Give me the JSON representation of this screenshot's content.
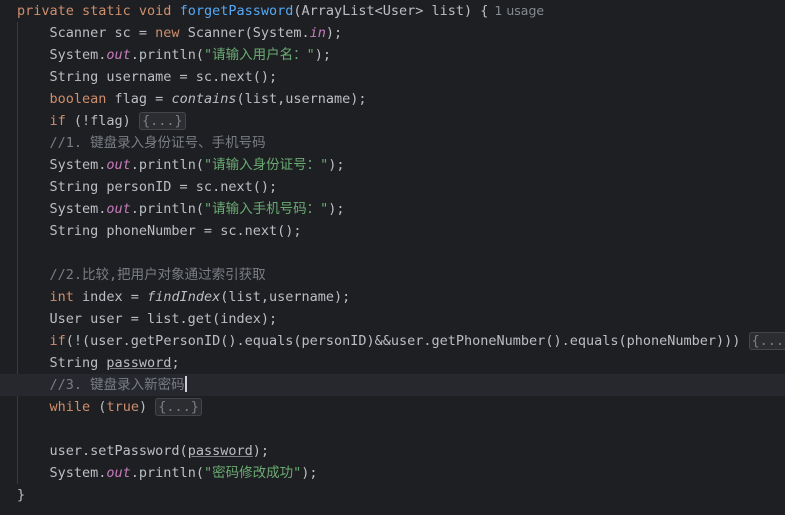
{
  "editor": {
    "usage_hint": "1 usage",
    "lines": [
      {
        "tokens": [
          {
            "t": "private static void ",
            "c": "kw"
          },
          {
            "t": "forgetPassword",
            "c": "fn"
          },
          {
            "t": "(ArrayList<User> list) {",
            "c": ""
          }
        ]
      },
      {
        "tokens": [
          {
            "t": "    Scanner sc = ",
            "c": ""
          },
          {
            "t": "new ",
            "c": "kw"
          },
          {
            "t": "Scanner(System.",
            "c": ""
          },
          {
            "t": "in",
            "c": "st"
          },
          {
            "t": ");",
            "c": ""
          }
        ]
      },
      {
        "tokens": [
          {
            "t": "    System.",
            "c": ""
          },
          {
            "t": "out",
            "c": "st"
          },
          {
            "t": ".println(",
            "c": ""
          },
          {
            "t": "\"请输入用户名：\"",
            "c": "str"
          },
          {
            "t": ");",
            "c": ""
          }
        ]
      },
      {
        "tokens": [
          {
            "t": "    String username = sc.next();",
            "c": ""
          }
        ]
      },
      {
        "tokens": [
          {
            "t": "    ",
            "c": ""
          },
          {
            "t": "boolean ",
            "c": "kw"
          },
          {
            "t": "flag = ",
            "c": ""
          },
          {
            "t": "contains",
            "c": "it"
          },
          {
            "t": "(list,username);",
            "c": ""
          }
        ]
      },
      {
        "tokens": [
          {
            "t": "    ",
            "c": ""
          },
          {
            "t": "if ",
            "c": "kw"
          },
          {
            "t": "(!flag) ",
            "c": ""
          },
          {
            "t": "{...}",
            "c": "fold"
          }
        ]
      },
      {
        "tokens": [
          {
            "t": "    //1. 键盘录入身份证号、手机号码",
            "c": "cm"
          }
        ]
      },
      {
        "tokens": [
          {
            "t": "    System.",
            "c": ""
          },
          {
            "t": "out",
            "c": "st"
          },
          {
            "t": ".println(",
            "c": ""
          },
          {
            "t": "\"请输入身份证号：\"",
            "c": "str"
          },
          {
            "t": ");",
            "c": ""
          }
        ]
      },
      {
        "tokens": [
          {
            "t": "    String personID = sc.next();",
            "c": ""
          }
        ]
      },
      {
        "tokens": [
          {
            "t": "    System.",
            "c": ""
          },
          {
            "t": "out",
            "c": "st"
          },
          {
            "t": ".println(",
            "c": ""
          },
          {
            "t": "\"请输入手机号码：\"",
            "c": "str"
          },
          {
            "t": ");",
            "c": ""
          }
        ]
      },
      {
        "tokens": [
          {
            "t": "    String phoneNumber = sc.next();",
            "c": ""
          }
        ]
      },
      {
        "tokens": []
      },
      {
        "tokens": [
          {
            "t": "    //2.比较,把用户对象通过索引获取",
            "c": "cm"
          }
        ]
      },
      {
        "tokens": [
          {
            "t": "    ",
            "c": ""
          },
          {
            "t": "int ",
            "c": "kw"
          },
          {
            "t": "index = ",
            "c": ""
          },
          {
            "t": "findIndex",
            "c": "it"
          },
          {
            "t": "(list,username);",
            "c": ""
          }
        ]
      },
      {
        "tokens": [
          {
            "t": "    User user = list.get(index);",
            "c": ""
          }
        ]
      },
      {
        "tokens": [
          {
            "t": "    ",
            "c": ""
          },
          {
            "t": "if",
            "c": "kw"
          },
          {
            "t": "(!(user.getPersonID().equals(personID)&&user.getPhoneNumber().equals(phoneNumber))) ",
            "c": ""
          },
          {
            "t": "{...}",
            "c": "fold"
          }
        ]
      },
      {
        "tokens": [
          {
            "t": "    String ",
            "c": ""
          },
          {
            "t": "password",
            "c": "ul"
          },
          {
            "t": ";",
            "c": ""
          }
        ]
      },
      {
        "tokens": [
          {
            "t": "    //3. 键盘录入新密码",
            "c": "cm"
          }
        ]
      },
      {
        "tokens": [
          {
            "t": "    ",
            "c": ""
          },
          {
            "t": "while ",
            "c": "kw"
          },
          {
            "t": "(",
            "c": ""
          },
          {
            "t": "true",
            "c": "kw"
          },
          {
            "t": ") ",
            "c": ""
          },
          {
            "t": "{...}",
            "c": "fold"
          }
        ]
      },
      {
        "tokens": []
      },
      {
        "tokens": [
          {
            "t": "    user.setPassword(",
            "c": ""
          },
          {
            "t": "password",
            "c": "ul"
          },
          {
            "t": ");",
            "c": ""
          }
        ]
      },
      {
        "tokens": [
          {
            "t": "    System.",
            "c": ""
          },
          {
            "t": "out",
            "c": "st"
          },
          {
            "t": ".println(",
            "c": ""
          },
          {
            "t": "\"密码修改成功\"",
            "c": "str"
          },
          {
            "t": ");",
            "c": ""
          }
        ]
      },
      {
        "tokens": [
          {
            "t": "}",
            "c": ""
          }
        ]
      }
    ]
  }
}
